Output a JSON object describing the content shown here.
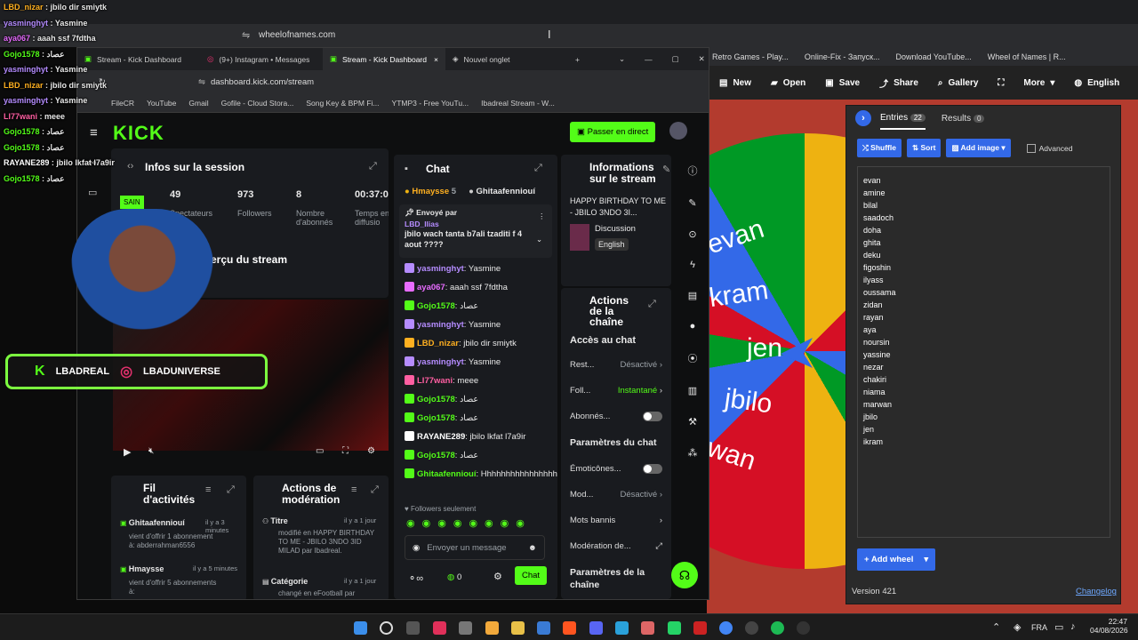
{
  "back_browser": {
    "address": "wheelofnames.com",
    "bookmarks": [
      "Retro Games - Play...",
      "Online-Fix - Запуск...",
      "Download YouTube...",
      "Wheel of Names | R..."
    ]
  },
  "wheel_app": {
    "toolbar": {
      "new": "New",
      "open": "Open",
      "save": "Save",
      "share": "Share",
      "gallery": "Gallery",
      "more": "More",
      "language": "English"
    },
    "tabs": {
      "entries": "Entries",
      "entries_count": "22",
      "results": "Results",
      "results_count": "0"
    },
    "buttons": {
      "shuffle": "Shuffle",
      "sort": "Sort",
      "add_image": "Add image",
      "advanced": "Advanced",
      "add_wheel": "Add wheel"
    },
    "entries": [
      "evan",
      "amine",
      "bilal",
      "saadoch",
      "doha",
      "ghita",
      "deku",
      "figoshin",
      "ilyass",
      "oussama",
      "zidan",
      "rayan",
      "aya",
      "noursin",
      "yassine",
      "nezar",
      "chakiri",
      "niama",
      "marwan",
      "jbilo",
      "jen",
      "ikram"
    ],
    "version": "Version 421",
    "changelog": "Changelog",
    "wheel_labels": [
      "evan",
      "ikram",
      "jen",
      "jbilo",
      "wan"
    ],
    "colors": {
      "blue": "#3369e8",
      "red": "#d50f25",
      "green": "#009925",
      "yellow": "#eeb211"
    }
  },
  "front_browser": {
    "tabs": [
      "Stream - Kick Dashboard",
      "(9+) Instagram • Messages",
      "Stream - Kick Dashboard",
      "Nouvel onglet"
    ],
    "address": "dashboard.kick.com/stream",
    "bookmarks": [
      "FileCR",
      "YouTube",
      "Gmail",
      "Gofile - Cloud Stora...",
      "Song Key & BPM Fi...",
      "YTMP3 - Free YouTu...",
      "Ibadreal Stream - W..."
    ]
  },
  "kick": {
    "logo": "KICK",
    "go_live": "Passer en direct",
    "session": {
      "title": "Infos sur la session",
      "status": "SAIN",
      "stats": [
        {
          "value": "49",
          "label": "Spectateurs"
        },
        {
          "value": "973",
          "label": "Followers"
        },
        {
          "value": "8",
          "label": "Nombre d'abonnés"
        },
        {
          "value": "00:37:0",
          "label": "Temps en diffusio"
        }
      ]
    },
    "preview_title": "Aperçu du stream",
    "chat": {
      "title": "Chat",
      "top_users": [
        {
          "name": "Hmaysse",
          "count": "5"
        },
        {
          "name": "Ghitaafenniouí",
          "count": ""
        }
      ],
      "pinned_label": "Envoyé par",
      "pinned_user": "LBD_Ilias",
      "pinned_text": "jbilo wach tanta b7ali tzaditi f 4 aout ????",
      "messages": [
        {
          "user": "yasminghyt",
          "text": "Yasmine",
          "color": "#b58cff"
        },
        {
          "user": "aya067",
          "text": "aaah ssf 7fdtha",
          "color": "#e86cff"
        },
        {
          "user": "Gojo1578",
          "text": "عصاد",
          "color": "#53fc18"
        },
        {
          "user": "yasminghyt",
          "text": "Yasmine",
          "color": "#b58cff"
        },
        {
          "user": "LBD_nizar",
          "text": "jbilo dir smiytk",
          "color": "#ffb020"
        },
        {
          "user": "yasminghyt",
          "text": "Yasmine",
          "color": "#b58cff"
        },
        {
          "user": "LI77wani",
          "text": "meee",
          "color": "#ff5fa2"
        },
        {
          "user": "Gojo1578",
          "text": "عصاد",
          "color": "#53fc18"
        },
        {
          "user": "Gojo1578",
          "text": "عصاد",
          "color": "#53fc18"
        },
        {
          "user": "RAYANE289",
          "text": "jbilo lkfat l7a9ir",
          "color": "#ffffff"
        },
        {
          "user": "Gojo1578",
          "text": "عصاد",
          "color": "#53fc18"
        },
        {
          "user": "Ghitaafenniouí",
          "text": "Hhhhhhhhhhhhhhhhhhhhhh",
          "color": "#53fc18"
        }
      ],
      "followers_only": "Followers seulement",
      "input_placeholder": "Envoyer un message",
      "count": "0",
      "send": "Chat"
    },
    "stream_info": {
      "title": "Informations sur le stream",
      "stream_title": "HAPPY BIRTHDAY TO ME - JBILO 3NDO 3I...",
      "category": "Discussion",
      "language": "English"
    },
    "channel_actions": {
      "title": "Actions de la chaîne",
      "chat_access": "Accès au chat",
      "rows1": [
        {
          "label": "Rest...",
          "value": "Désactivé"
        },
        {
          "label": "Foll...",
          "value": "Instantané"
        },
        {
          "label": "Abonnés...",
          "value": ""
        }
      ],
      "chat_params": "Paramètres du chat",
      "rows2": [
        {
          "label": "Émoticônes...",
          "value": ""
        },
        {
          "label": "Mod...",
          "value": "Désactivé"
        },
        {
          "label": "Mots bannis",
          "value": ""
        },
        {
          "label": "Modération de...",
          "value": ""
        }
      ],
      "channel_params": "Paramètres de la chaîne"
    },
    "activity": {
      "title": "Fil d'activités",
      "items": [
        {
          "user": "Ghitaafenniouí",
          "time": "il y a 3 minutes",
          "text": "vient d'offrir 1 abonnement à: abderrahman6556"
        },
        {
          "user": "Hmaysse",
          "time": "il y a 5 minutes",
          "text": "vient d'offrir 5 abonnements à:"
        }
      ]
    },
    "moderation": {
      "title": "Actions de modération",
      "items": [
        {
          "type": "Titre",
          "time": "il y a 1 jour",
          "text": "modifié en HAPPY BIRTHDAY TO ME - JBILO 3NDO 3ID MILAD par Ibadreal."
        },
        {
          "type": "Catégorie",
          "time": "il y a 1 jour",
          "text": "changé en eFootball par"
        }
      ]
    }
  },
  "overlay": {
    "socials": [
      "LBADREAL",
      "LBADUNIVERSE"
    ],
    "chat": [
      {
        "user": "LBD_nizar",
        "text": "jbilo dir smiytk",
        "color": "#ffb020"
      },
      {
        "user": "yasminghyt",
        "text": "Yasmine",
        "color": "#b58cff"
      },
      {
        "user": "aya067",
        "text": "aaah ssf 7fdtha",
        "color": "#e86cff"
      },
      {
        "user": "Gojo1578",
        "text": "عصاد",
        "color": "#53fc18"
      },
      {
        "user": "yasminghyt",
        "text": "Yasmine",
        "color": "#b58cff"
      },
      {
        "user": "LBD_nizar",
        "text": "jbilo dir smiytk",
        "color": "#ffb020"
      },
      {
        "user": "yasminghyt",
        "text": "Yasmine",
        "color": "#b58cff"
      },
      {
        "user": "LI77wani",
        "text": "meee",
        "color": "#ff5fa2"
      },
      {
        "user": "Gojo1578",
        "text": "عصاد",
        "color": "#53fc18"
      },
      {
        "user": "Gojo1578",
        "text": "عصاد",
        "color": "#53fc18"
      },
      {
        "user": "RAYANE289",
        "text": "jbilo lkfat l7a9ir",
        "color": "#ffffff"
      },
      {
        "user": "Gojo1578",
        "text": "عصاد",
        "color": "#53fc18"
      }
    ]
  },
  "taskbar": {
    "lang": "FRA",
    "time": "22:47",
    "date": "04/08/2026"
  }
}
